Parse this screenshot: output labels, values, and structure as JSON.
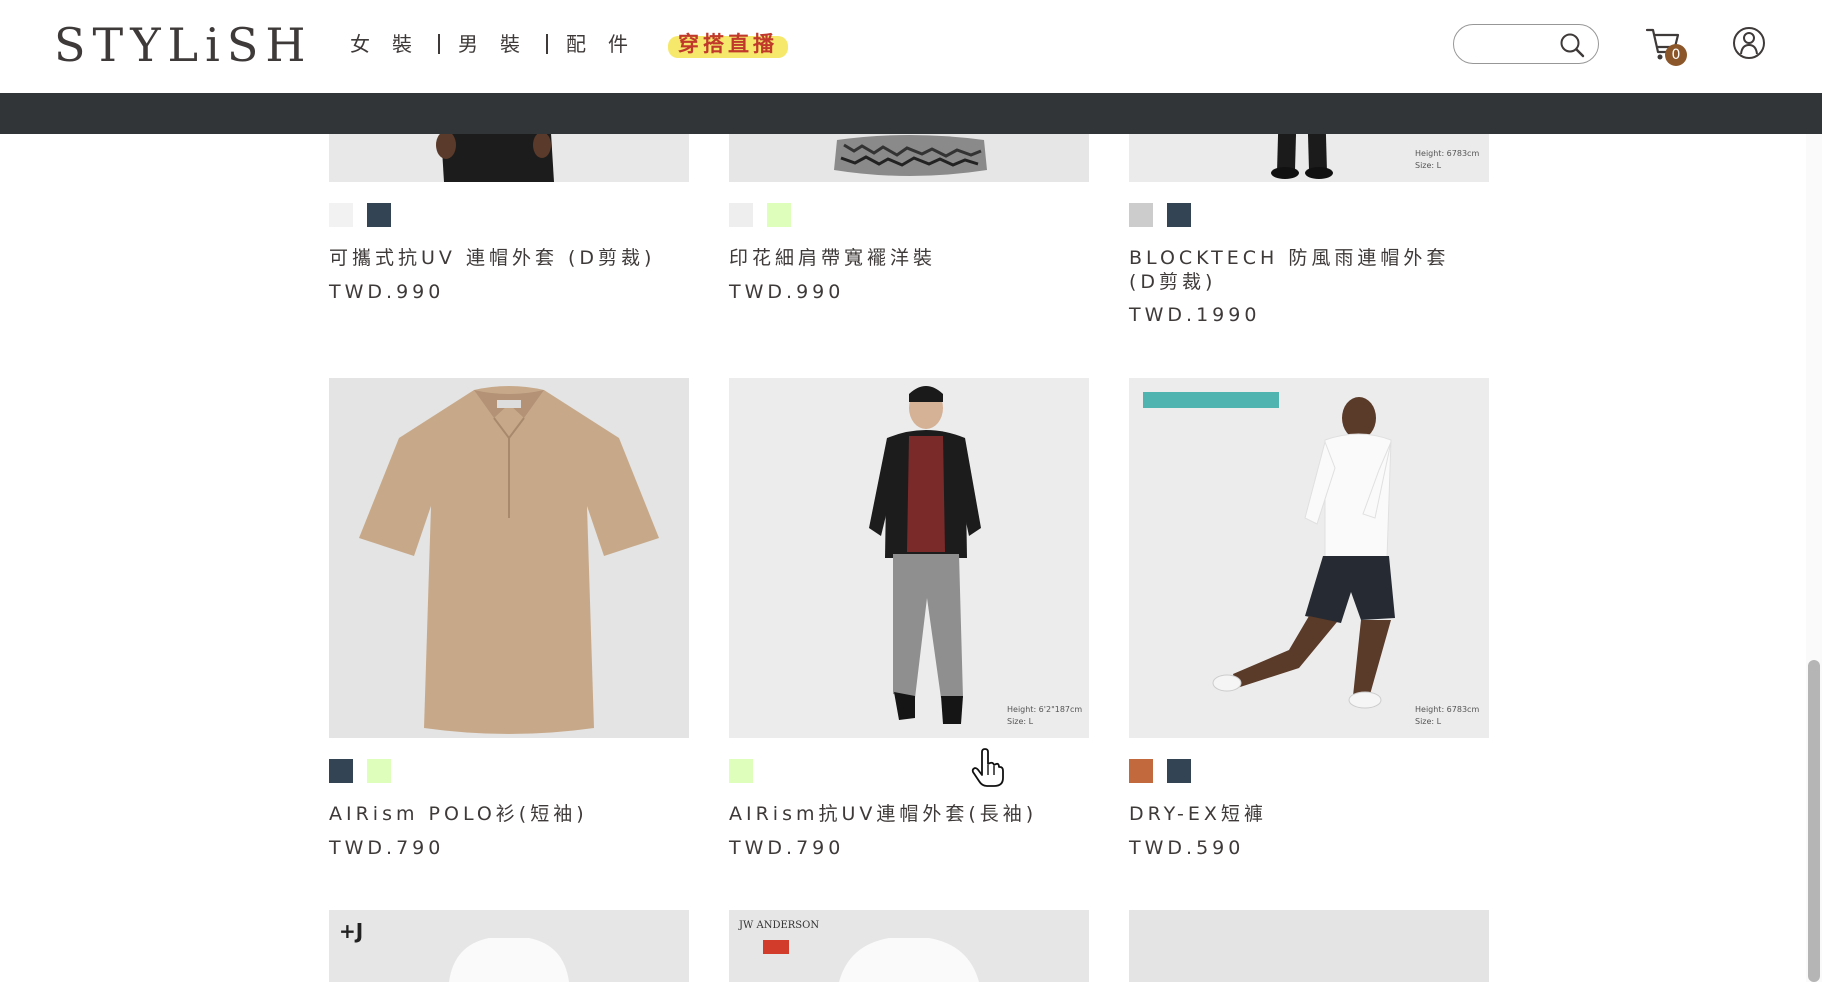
{
  "header": {
    "logo": "STYLiSH",
    "nav": [
      {
        "label": "女裝"
      },
      {
        "label": "男裝"
      },
      {
        "label": "配件"
      }
    ],
    "live_label": "穿搭直播",
    "search": {
      "placeholder": "",
      "value": ""
    },
    "cart_count": "0"
  },
  "products": [
    {
      "title": "可攜式抗UV 連帽外套 (D剪裁)",
      "price": "TWD.990",
      "colors": [
        "#f2f2f2",
        "#334455"
      ]
    },
    {
      "title": "印花細肩帶寬襬洋裝",
      "price": "TWD.990",
      "colors": [
        "#eeeeee",
        "#ddffbb"
      ]
    },
    {
      "title": "BLOCKTECH 防風雨連帽外套 (D剪裁)",
      "price": "TWD.1990",
      "colors": [
        "#cccccc",
        "#334455"
      ]
    },
    {
      "title": "AIRism POLO衫(短袖)",
      "price": "TWD.790",
      "colors": [
        "#334455",
        "#ddffbb"
      ]
    },
    {
      "title": "AIRism抗UV連帽外套(長袖)",
      "price": "TWD.790",
      "colors": [
        "#ddffbb"
      ]
    },
    {
      "title": "DRY-EX短褲",
      "price": "TWD.590",
      "colors": [
        "#c2693e",
        "#334455"
      ]
    }
  ],
  "image_captions": {
    "height_1": "Height: 6783cm",
    "size_1": "Size: L",
    "height_2": "Height: 6'2\"187cm",
    "size_2": "Size: L",
    "height_3": "Height: 6783cm",
    "size_3": "Size: L",
    "brand_tag": "JW ANDERSON"
  },
  "colors": {
    "dark_bar": "#313538",
    "text": "#3f3a3a",
    "live_highlight": "#f5e86b",
    "live_text": "#c0392b",
    "cart_badge": "#8b572a"
  }
}
